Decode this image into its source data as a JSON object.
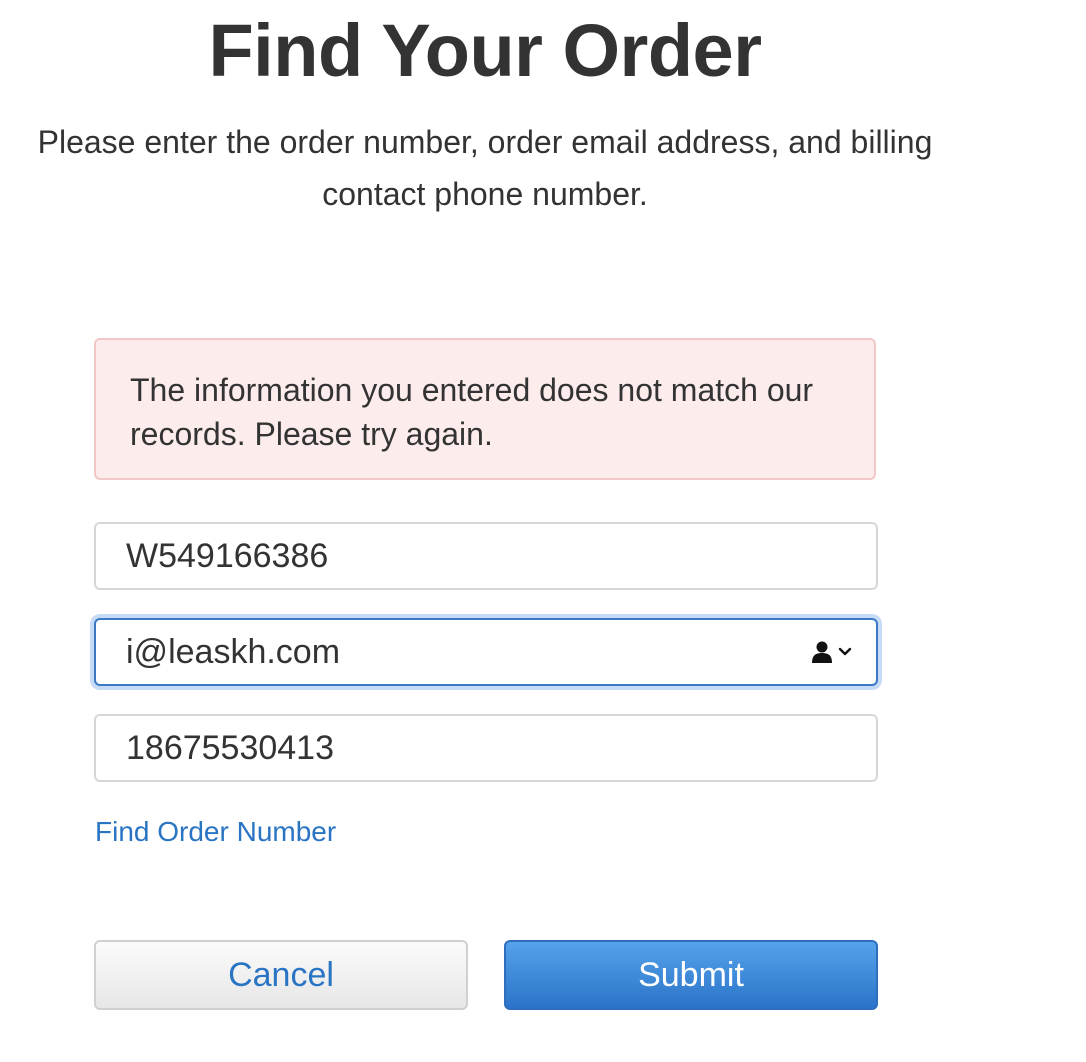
{
  "header": {
    "title": "Find Your Order",
    "subtitle": "Please enter the order number, order email address, and billing contact phone number."
  },
  "error": {
    "message": "The information you entered does not match our records. Please try again."
  },
  "form": {
    "order_number": "W549166386",
    "email": "i@leaskh.com",
    "phone": "18675530413"
  },
  "links": {
    "find_order_number": "Find Order Number"
  },
  "buttons": {
    "cancel": "Cancel",
    "submit": "Submit"
  },
  "icons": {
    "autofill": "contact-autofill-icon",
    "chevron": "chevron-down-icon"
  },
  "colors": {
    "link": "#2a74c4",
    "submit": "#2b73c9",
    "error_bg": "#fcecec",
    "focus": "#3b78c4"
  }
}
